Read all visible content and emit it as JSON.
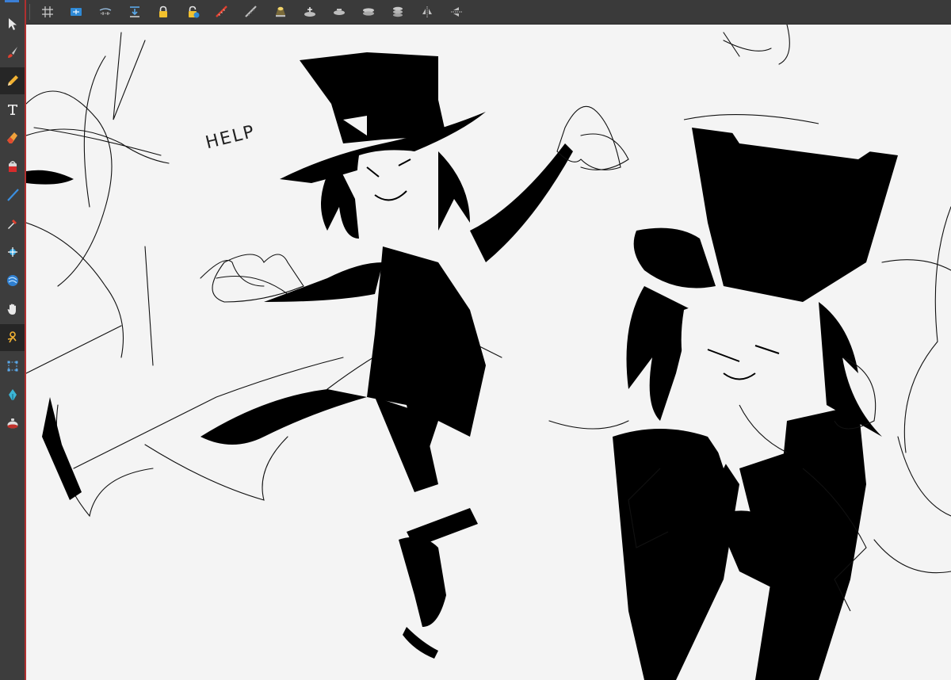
{
  "toolbar_left": {
    "tools": [
      {
        "name": "select-tool",
        "icon": "cursor-arrow-icon"
      },
      {
        "name": "brush-tool",
        "icon": "brush-icon"
      },
      {
        "name": "pencil-tool",
        "icon": "pencil-icon",
        "active": true
      },
      {
        "name": "text-tool",
        "icon": "text-t-icon"
      },
      {
        "name": "eraser-tool",
        "icon": "eraser-icon"
      },
      {
        "name": "paint-bucket-tool",
        "icon": "paint-bucket-icon"
      },
      {
        "name": "line-tool",
        "icon": "line-icon"
      },
      {
        "name": "dropper-tool",
        "icon": "eyedropper-icon"
      },
      {
        "name": "crosshair-tool",
        "icon": "crosshair-icon"
      },
      {
        "name": "contour-tool",
        "icon": "contour-icon"
      },
      {
        "name": "hand-tool",
        "icon": "hand-icon"
      },
      {
        "name": "rig-tool",
        "icon": "rig-joint-icon",
        "active": true
      },
      {
        "name": "transform-tool",
        "icon": "transform-box-icon"
      },
      {
        "name": "pen-tool",
        "icon": "pen-nib-icon"
      },
      {
        "name": "cutter-tool",
        "icon": "pot-icon"
      }
    ]
  },
  "toolbar_top": {
    "icons": [
      "grid-icon",
      "onion-skin-icon",
      "light-table-icon",
      "import-icon",
      "lock-icon",
      "lock-unlock-icon",
      "ruler-red-icon",
      "ruler-grey-icon",
      "spotlight-icon",
      "layer-add-icon",
      "layer-remove-icon",
      "layer-stack-icon",
      "layer-merge-icon",
      "flip-horizontal-icon",
      "flip-vertical-icon"
    ]
  },
  "canvas": {
    "annotation_text": "HELP"
  },
  "colors": {
    "toolbar_bg": "#3a3a3a",
    "canvas_bg": "#f4f4f4",
    "accent_red": "#b03030",
    "accent_blue": "#3b7fd6",
    "ink": "#000000"
  }
}
